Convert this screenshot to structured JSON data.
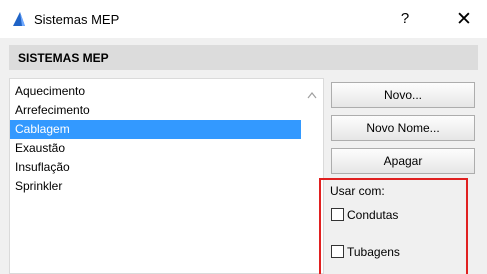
{
  "window": {
    "title": "Sistemas MEP",
    "help_glyph": "?",
    "close_glyph": "✕"
  },
  "section": {
    "header": "SISTEMAS MEP"
  },
  "list": {
    "items": [
      "Aquecimento",
      "Arrefecimento",
      "Cablagem",
      "Exaustão",
      "Insuflação",
      "Sprinkler"
    ],
    "selected": "Cablagem"
  },
  "buttons": {
    "novo": "Novo...",
    "novo_nome": "Novo Nome...",
    "apagar": "Apagar"
  },
  "usar_com": {
    "label": "Usar com:",
    "options": [
      {
        "label": "Condutas",
        "checked": false
      },
      {
        "label": "Tubagens",
        "checked": false
      }
    ]
  },
  "colors": {
    "selection": "#3399ff",
    "highlight_box": "#e02020"
  },
  "icons": {
    "app": "archicad-triangle-icon",
    "scroll": "scroll-up-arrow-icon"
  }
}
